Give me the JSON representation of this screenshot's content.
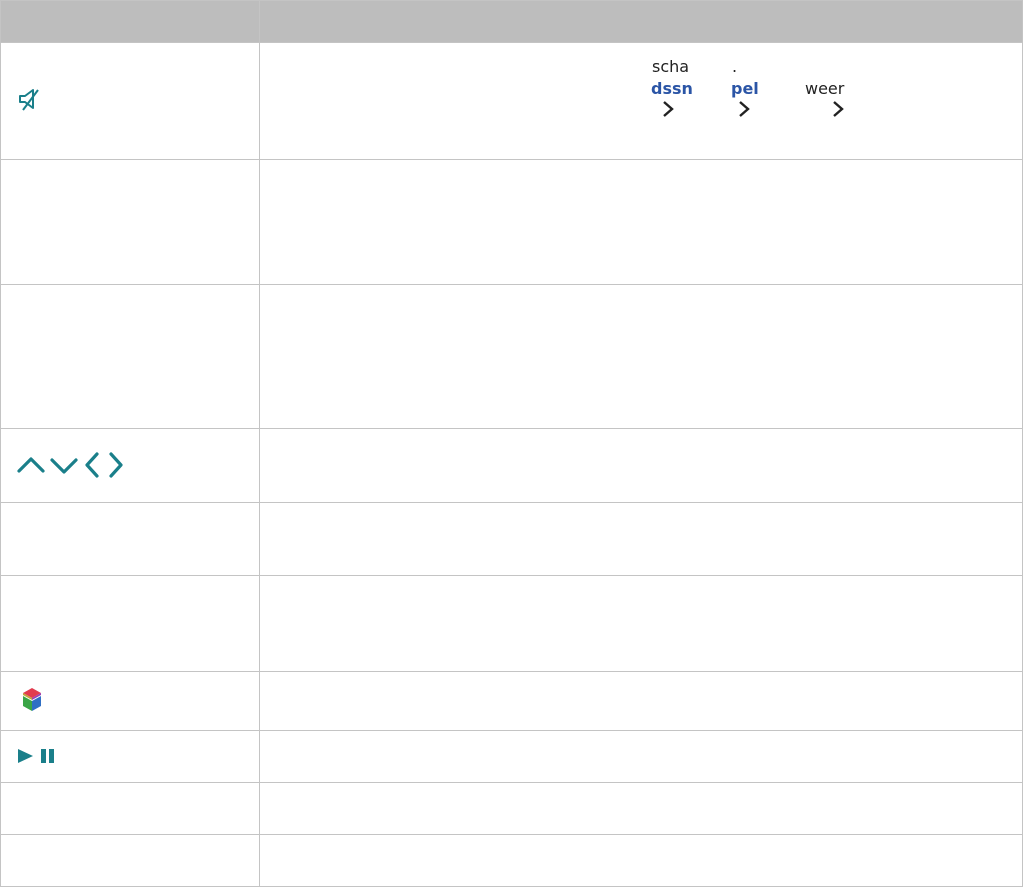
{
  "table": {
    "header": {
      "col1": "",
      "col2": ""
    },
    "row1": {
      "icon": "mute-icon",
      "words": {
        "w1": "scha",
        "w2": ".",
        "w3": "dssn",
        "w4": "pel",
        "w5": "weer"
      }
    },
    "row4": {
      "icon": "arrow-keys-icon"
    },
    "row7": {
      "icon": "smart-hub-icon"
    },
    "row8": {
      "icon": "play-pause-icon"
    }
  },
  "colors": {
    "header": "#bdbdbd",
    "border": "#c4c4c4",
    "icon_teal": "#1a7f8a",
    "link_blue": "#2b55a6"
  }
}
